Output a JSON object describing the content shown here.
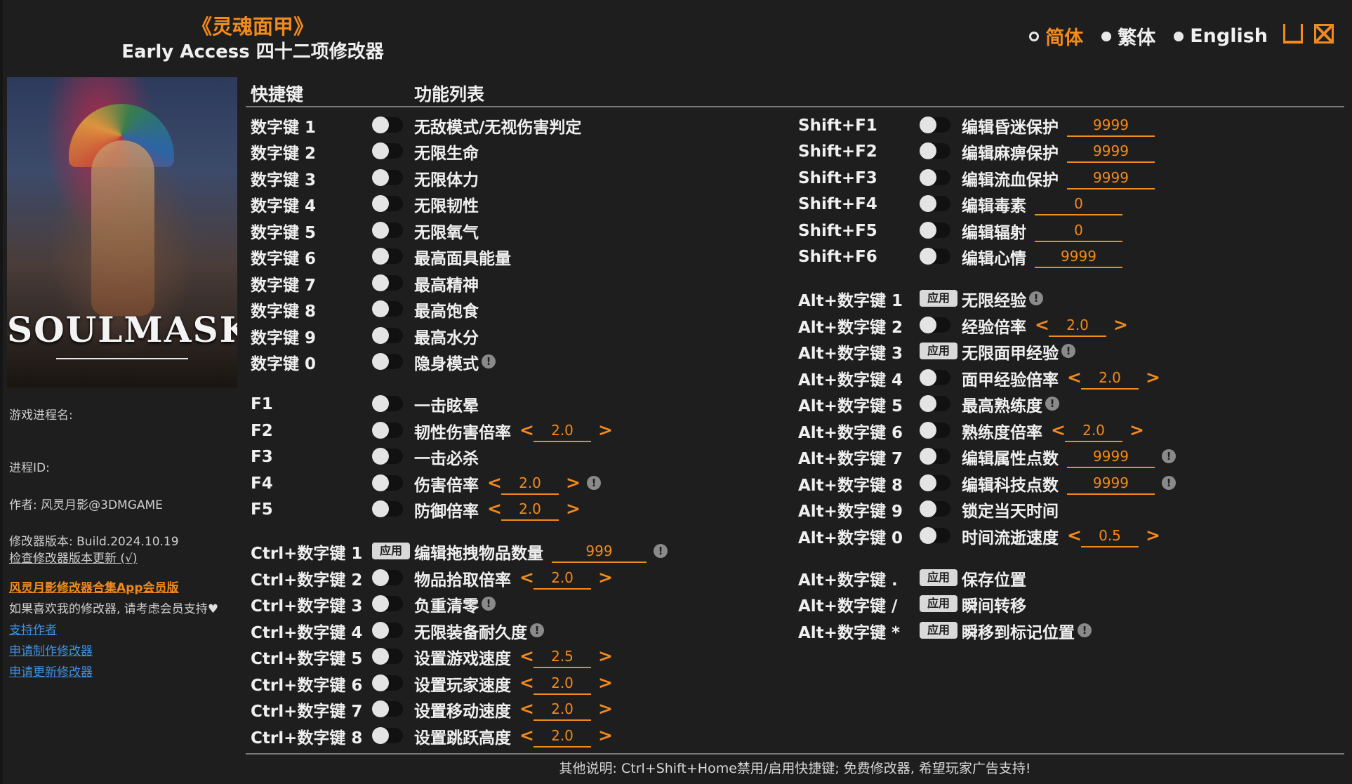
{
  "header": {
    "title": "《灵魂面甲》",
    "subtitle": "Early Access 四十二项修改器"
  },
  "languages": [
    {
      "label": "简体",
      "selected": true
    },
    {
      "label": "繁体",
      "selected": false
    },
    {
      "label": "English",
      "selected": false
    }
  ],
  "window_controls": {
    "minimize": "minimize-icon",
    "close": "close-icon"
  },
  "cover": {
    "logo_text": "SOULMASK"
  },
  "sidebar": {
    "process_name": "游戏进程名:",
    "process_id": "进程ID:",
    "author": "作者: 风灵月影@3DMGAME",
    "version": "修改器版本: Build.2024.10.19",
    "check_update": "检查修改器版本更新 (√)",
    "promo": "风灵月影修改器合集App会员版",
    "support_note": "如果喜欢我的修改器, 请考虑会员支持",
    "links": [
      "支持作者",
      "申请制作修改器",
      "申请更新修改器"
    ]
  },
  "columns": {
    "hotkey": "快捷键",
    "features": "功能列表"
  },
  "apply_label": "应用",
  "arrow_left": "<",
  "arrow_right": ">",
  "warn_symbol": "!",
  "accent_color": "#f28a1c",
  "left_rows": [
    {
      "key": "数字键 1",
      "label": "无敌模式/无视伤害判定",
      "type": "toggle"
    },
    {
      "key": "数字键 2",
      "label": "无限生命",
      "type": "toggle"
    },
    {
      "key": "数字键 3",
      "label": "无限体力",
      "type": "toggle"
    },
    {
      "key": "数字键 4",
      "label": "无限韧性",
      "type": "toggle"
    },
    {
      "key": "数字键 5",
      "label": "无限氧气",
      "type": "toggle"
    },
    {
      "key": "数字键 6",
      "label": "最高面具能量",
      "type": "toggle"
    },
    {
      "key": "数字键 7",
      "label": "最高精神",
      "type": "toggle"
    },
    {
      "key": "数字键 8",
      "label": "最高饱食",
      "type": "toggle"
    },
    {
      "key": "数字键 9",
      "label": "最高水分",
      "type": "toggle"
    },
    {
      "key": "数字键 0",
      "label": "隐身模式",
      "type": "toggle",
      "warn": true
    },
    {
      "key": "F1",
      "label": "一击眩晕",
      "type": "toggle"
    },
    {
      "key": "F2",
      "label": "韧性伤害倍率",
      "type": "toggle",
      "stepper": "2.0"
    },
    {
      "key": "F3",
      "label": "一击必杀",
      "type": "toggle"
    },
    {
      "key": "F4",
      "label": "伤害倍率",
      "type": "toggle",
      "stepper": "2.0",
      "warn": true
    },
    {
      "key": "F5",
      "label": "防御倍率",
      "type": "toggle",
      "stepper": "2.0"
    },
    {
      "key": "Ctrl+数字键 1",
      "label": "编辑拖拽物品数量",
      "type": "apply",
      "value": "999",
      "warn": true
    },
    {
      "key": "Ctrl+数字键 2",
      "label": "物品拾取倍率",
      "type": "toggle",
      "stepper": "2.0"
    },
    {
      "key": "Ctrl+数字键 3",
      "label": "负重清零",
      "type": "toggle",
      "warn": true
    },
    {
      "key": "Ctrl+数字键 4",
      "label": "无限装备耐久度",
      "type": "toggle",
      "warn": true
    },
    {
      "key": "Ctrl+数字键 5",
      "label": "设置游戏速度",
      "type": "toggle",
      "stepper": "2.5"
    },
    {
      "key": "Ctrl+数字键 6",
      "label": "设置玩家速度",
      "type": "toggle",
      "stepper": "2.0"
    },
    {
      "key": "Ctrl+数字键 7",
      "label": "设置移动速度",
      "type": "toggle",
      "stepper": "2.0"
    },
    {
      "key": "Ctrl+数字键 8",
      "label": "设置跳跃高度",
      "type": "toggle",
      "stepper": "2.0"
    }
  ],
  "right_rows": [
    {
      "key": "Shift+F1",
      "label": "编辑昏迷保护",
      "type": "toggle",
      "value": "9999"
    },
    {
      "key": "Shift+F2",
      "label": "编辑麻痹保护",
      "type": "toggle",
      "value": "9999"
    },
    {
      "key": "Shift+F3",
      "label": "编辑流血保护",
      "type": "toggle",
      "value": "9999"
    },
    {
      "key": "Shift+F4",
      "label": "编辑毒素",
      "type": "toggle",
      "value": "0"
    },
    {
      "key": "Shift+F5",
      "label": "编辑辐射",
      "type": "toggle",
      "value": "0"
    },
    {
      "key": "Shift+F6",
      "label": "编辑心情",
      "type": "toggle",
      "value": "9999"
    },
    {
      "key": "Alt+数字键 1",
      "label": "无限经验",
      "type": "apply",
      "warn": true
    },
    {
      "key": "Alt+数字键 2",
      "label": "经验倍率",
      "type": "toggle",
      "stepper": "2.0"
    },
    {
      "key": "Alt+数字键 3",
      "label": "无限面甲经验",
      "type": "apply",
      "warn": true
    },
    {
      "key": "Alt+数字键 4",
      "label": "面甲经验倍率",
      "type": "toggle",
      "stepper": "2.0"
    },
    {
      "key": "Alt+数字键 5",
      "label": "最高熟练度",
      "type": "toggle",
      "warn": true
    },
    {
      "key": "Alt+数字键 6",
      "label": "熟练度倍率",
      "type": "toggle",
      "stepper": "2.0"
    },
    {
      "key": "Alt+数字键 7",
      "label": "编辑属性点数",
      "type": "toggle",
      "value": "9999",
      "warn": true
    },
    {
      "key": "Alt+数字键 8",
      "label": "编辑科技点数",
      "type": "toggle",
      "value": "9999",
      "warn": true
    },
    {
      "key": "Alt+数字键 9",
      "label": "锁定当天时间",
      "type": "toggle"
    },
    {
      "key": "Alt+数字键 0",
      "label": "时间流逝速度",
      "type": "toggle",
      "stepper": "0.5"
    },
    {
      "key": "Alt+数字键 .",
      "label": "保存位置",
      "type": "apply"
    },
    {
      "key": "Alt+数字键 /",
      "label": "瞬间转移",
      "type": "apply"
    },
    {
      "key": "Alt+数字键 *",
      "label": "瞬移到标记位置",
      "type": "apply",
      "warn": true
    }
  ],
  "footer": "其他说明: Ctrl+Shift+Home禁用/启用快捷键; 免费修改器, 希望玩家广告支持!"
}
